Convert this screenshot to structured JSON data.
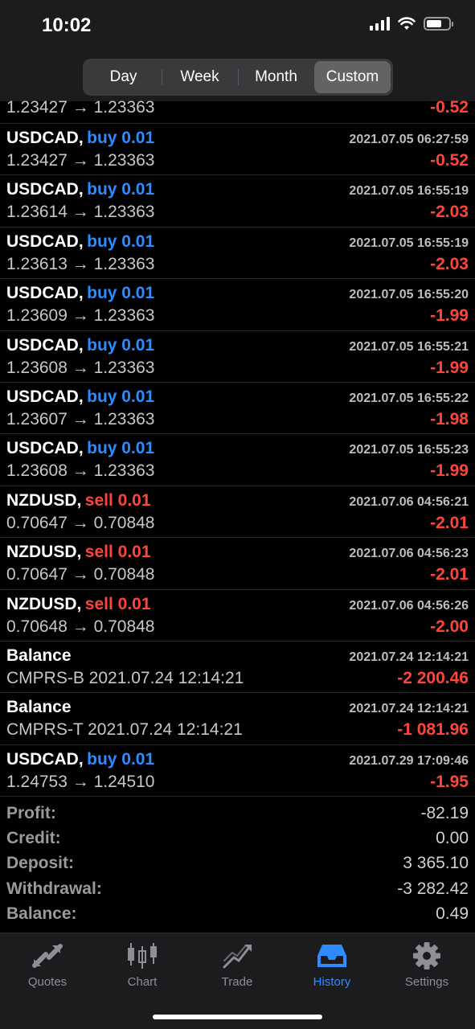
{
  "status_bar": {
    "time": "10:02"
  },
  "period_tabs": [
    {
      "label": "Day"
    },
    {
      "label": "Week"
    },
    {
      "label": "Month"
    },
    {
      "label": "Custom"
    }
  ],
  "first_row": {
    "prices": "1.23427 → 1.23363",
    "profit": "-0.52"
  },
  "deals": [
    {
      "symbol": "USDCAD,",
      "side": "buy 0.01",
      "time": "2021.07.05 06:27:59",
      "prices": "1.23427 → 1.23363",
      "profit": "-0.52"
    },
    {
      "symbol": "USDCAD,",
      "side": "buy 0.01",
      "time": "2021.07.05 16:55:19",
      "prices": "1.23614 → 1.23363",
      "profit": "-2.03"
    },
    {
      "symbol": "USDCAD,",
      "side": "buy 0.01",
      "time": "2021.07.05 16:55:19",
      "prices": "1.23613 → 1.23363",
      "profit": "-2.03"
    },
    {
      "symbol": "USDCAD,",
      "side": "buy 0.01",
      "time": "2021.07.05 16:55:20",
      "prices": "1.23609 → 1.23363",
      "profit": "-1.99"
    },
    {
      "symbol": "USDCAD,",
      "side": "buy 0.01",
      "time": "2021.07.05 16:55:21",
      "prices": "1.23608 → 1.23363",
      "profit": "-1.99"
    },
    {
      "symbol": "USDCAD,",
      "side": "buy 0.01",
      "time": "2021.07.05 16:55:22",
      "prices": "1.23607 → 1.23363",
      "profit": "-1.98"
    },
    {
      "symbol": "USDCAD,",
      "side": "buy 0.01",
      "time": "2021.07.05 16:55:23",
      "prices": "1.23608 → 1.23363",
      "profit": "-1.99"
    },
    {
      "symbol": "NZDUSD,",
      "side": "sell 0.01",
      "time": "2021.07.06 04:56:21",
      "prices": "0.70647 → 0.70848",
      "profit": "-2.01"
    },
    {
      "symbol": "NZDUSD,",
      "side": "sell 0.01",
      "time": "2021.07.06 04:56:23",
      "prices": "0.70647 → 0.70848",
      "profit": "-2.01"
    },
    {
      "symbol": "NZDUSD,",
      "side": "sell 0.01",
      "time": "2021.07.06 04:56:26",
      "prices": "0.70648 → 0.70848",
      "profit": "-2.00"
    },
    {
      "symbol": "Balance",
      "side": "",
      "time": "2021.07.24 12:14:21",
      "prices": "CMPRS-B 2021.07.24 12:14:21",
      "profit": "-2 200.46"
    },
    {
      "symbol": "Balance",
      "side": "",
      "time": "2021.07.24 12:14:21",
      "prices": "CMPRS-T 2021.07.24 12:14:21",
      "profit": "-1 081.96"
    },
    {
      "symbol": "USDCAD,",
      "side": "buy 0.01",
      "time": "2021.07.29 17:09:46",
      "prices": "1.24753 → 1.24510",
      "profit": "-1.95"
    }
  ],
  "summary": [
    {
      "label": "Profit:",
      "value": "-82.19"
    },
    {
      "label": "Credit:",
      "value": "0.00"
    },
    {
      "label": "Deposit:",
      "value": "3 365.10"
    },
    {
      "label": "Withdrawal:",
      "value": "-3 282.42"
    },
    {
      "label": "Balance:",
      "value": "0.49"
    }
  ],
  "tabbar": [
    {
      "label": "Quotes",
      "icon": "quotes-icon"
    },
    {
      "label": "Chart",
      "icon": "chart-icon"
    },
    {
      "label": "Trade",
      "icon": "trade-icon"
    },
    {
      "label": "History",
      "icon": "history-icon"
    },
    {
      "label": "Settings",
      "icon": "gear-icon"
    }
  ],
  "colors": {
    "buy": "#2d8cff",
    "sell": "#ff453a",
    "loss": "#ff453a",
    "active_tab": "#2d8cff"
  }
}
